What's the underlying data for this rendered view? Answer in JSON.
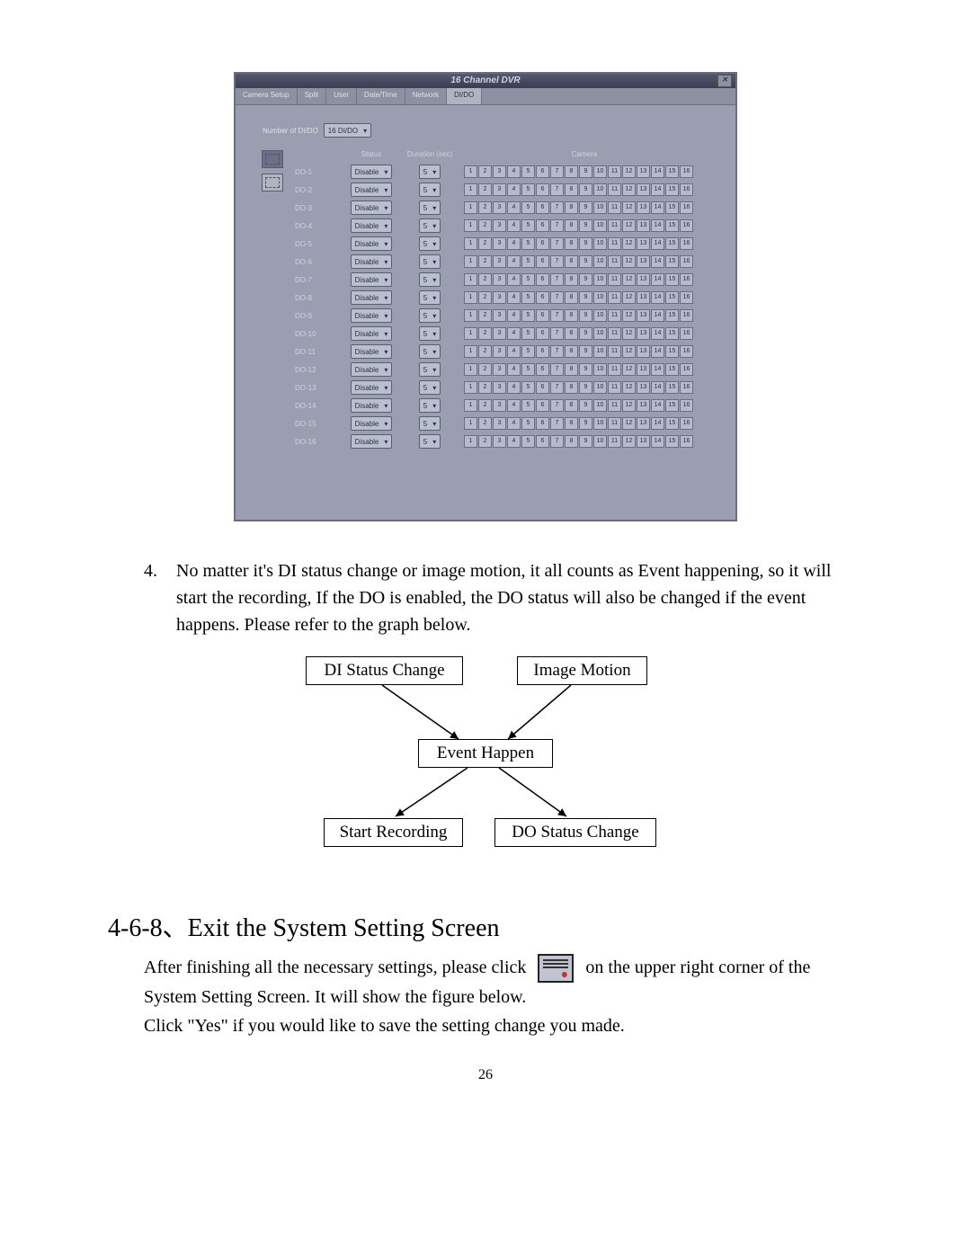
{
  "dvr": {
    "title": "16 Channel DVR",
    "tabs": [
      "Camera Setup",
      "Split",
      "User",
      "Date/Time",
      "Network",
      "DI/DO"
    ],
    "active_tab": 5,
    "dido_label": "Number of DI/DO",
    "dido_value": "16 DI/DO",
    "headers": {
      "status": "Status",
      "duration": "Duration (sec)",
      "camera": "Camera"
    },
    "status_value": "Disable",
    "duration_value": "5",
    "rows": [
      "DO-1",
      "DO-2",
      "DO-3",
      "DO-4",
      "DO-5",
      "DO-6",
      "DO-7",
      "DO-8",
      "DO-9",
      "DO-10",
      "DO-11",
      "DO-12",
      "DO-13",
      "DO-14",
      "DO-15",
      "DO-16"
    ],
    "cameras": [
      "1",
      "2",
      "3",
      "4",
      "5",
      "6",
      "7",
      "8",
      "9",
      "10",
      "11",
      "12",
      "13",
      "14",
      "15",
      "16"
    ]
  },
  "item4_number": "4.",
  "item4_text": "No matter it's DI status change or image motion, it all counts as Event happening, so it will start the recording, If the DO is enabled, the DO status will also be changed if the event happens. Please refer to the graph below.",
  "flow": {
    "di": "DI  Status  Change",
    "motion": "Image  Motion",
    "event": "Event Happen",
    "rec": "Start Recording",
    "doc": "DO  Status  Change"
  },
  "section_heading": "4-6-8、Exit the System Setting Screen",
  "section_body_1a": "After finishing all the necessary settings, please click",
  "section_body_1b": "on the upper right corner of the System Setting Screen. It will show the figure below.",
  "section_body_2": "Click \"Yes\" if you would like to save the setting change you made.",
  "page_number": "26"
}
